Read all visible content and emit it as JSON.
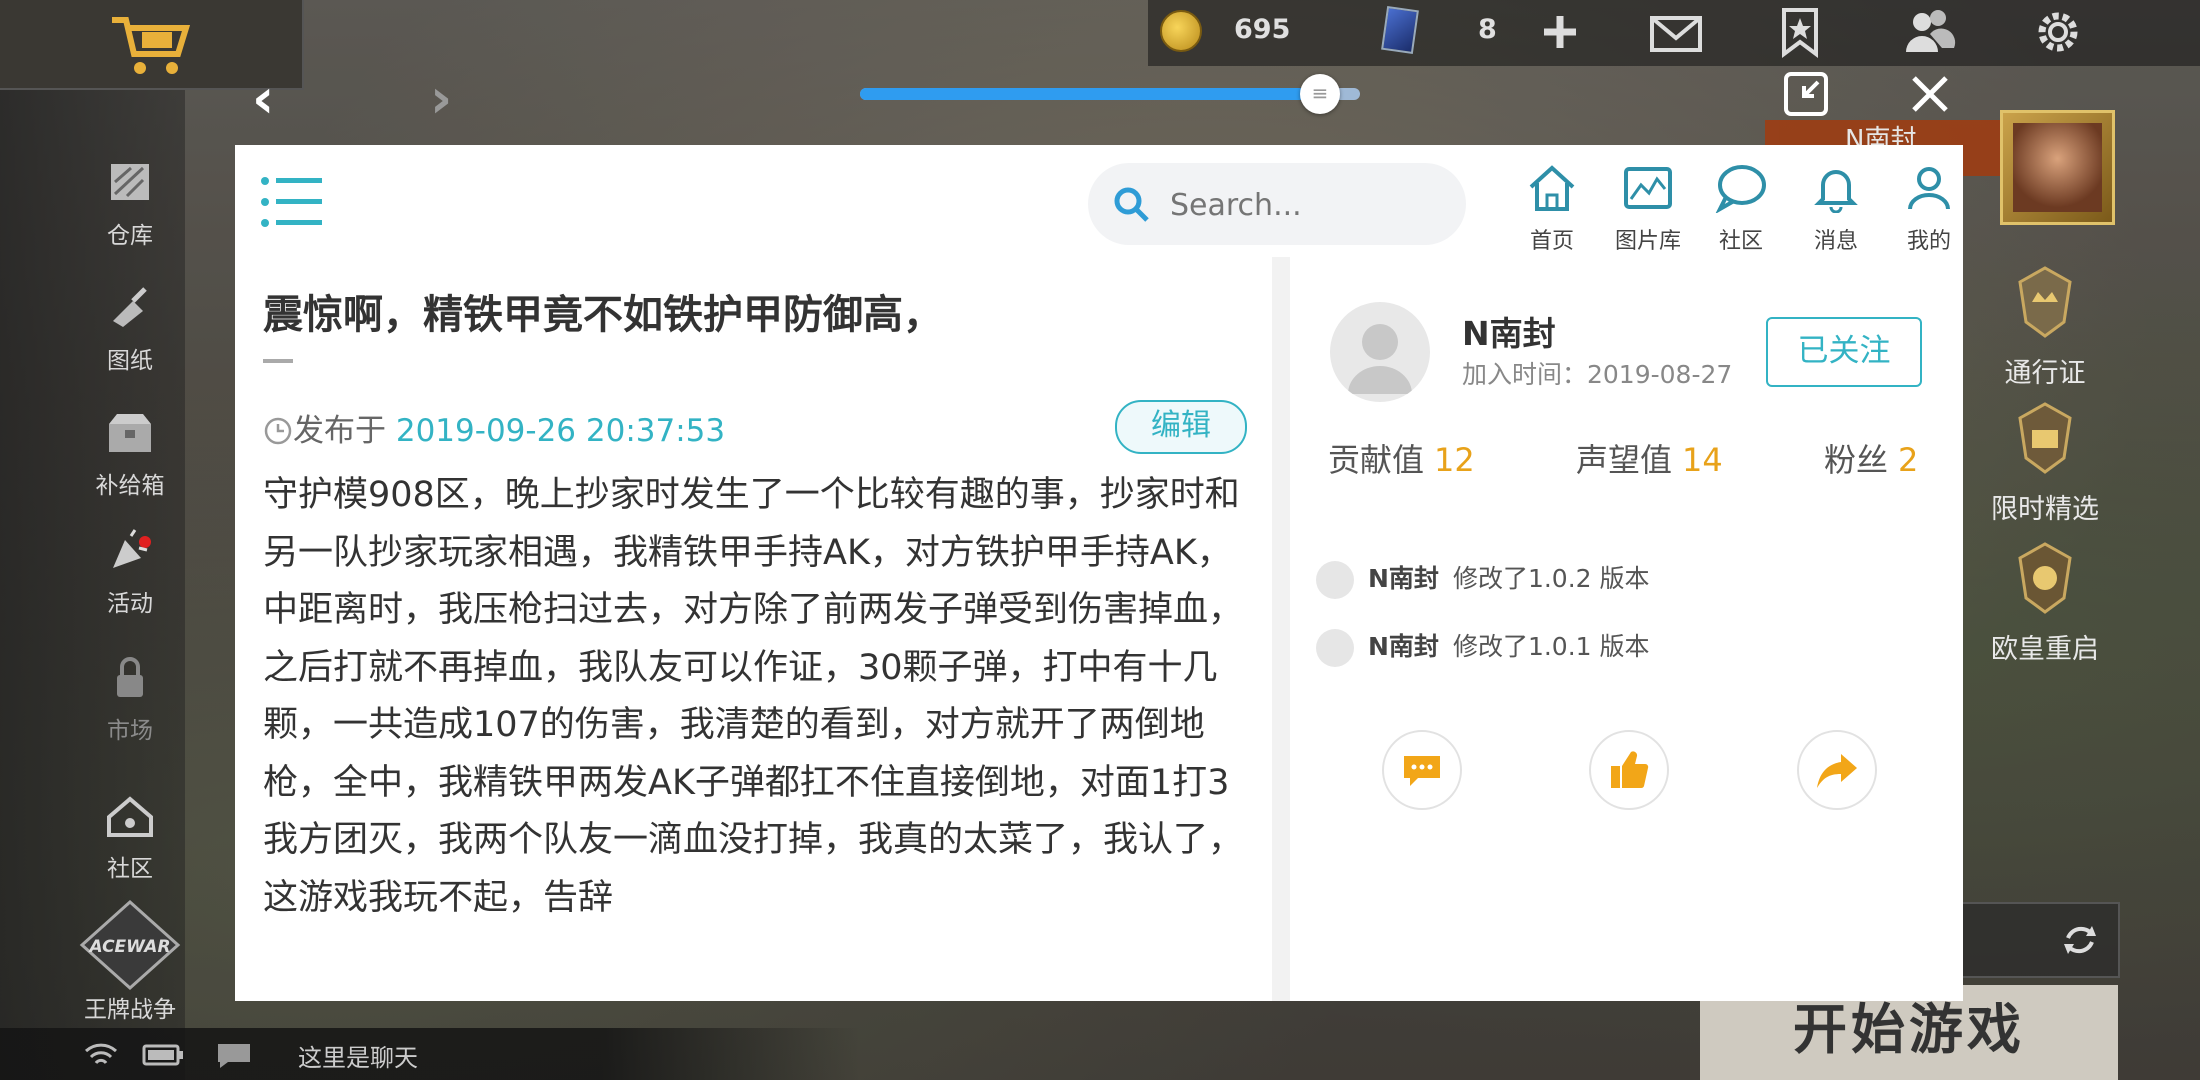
{
  "game": {
    "top_bar": {
      "coins": "695",
      "cards": "8"
    },
    "sidebar_items": [
      {
        "label": "仓库"
      },
      {
        "label": "图纸"
      },
      {
        "label": "补给箱"
      },
      {
        "label": "活动"
      },
      {
        "label": "市场"
      },
      {
        "label": "社区"
      },
      {
        "label": "王牌战争"
      }
    ],
    "right_items": [
      {
        "label": "通行证"
      },
      {
        "label": "限时精选"
      },
      {
        "label": "欧皇重启"
      }
    ],
    "player_badge": "N南封",
    "start_button": "开始游戏",
    "chat_placeholder": "这里是聊天"
  },
  "browser": {
    "progress": 0.92
  },
  "header": {
    "search_placeholder": "Search...",
    "nav": [
      {
        "label": "首页",
        "icon": "home-icon"
      },
      {
        "label": "图片库",
        "icon": "gallery-icon"
      },
      {
        "label": "社区",
        "icon": "chat-bubble-icon"
      },
      {
        "label": "消息",
        "icon": "bell-icon"
      },
      {
        "label": "我的",
        "icon": "user-icon"
      }
    ]
  },
  "article": {
    "title": "震惊啊，精铁甲竟不如铁护甲防御高，",
    "published_prefix": "发布于",
    "published_date": "2019-09-26 20:37:53",
    "edit_label": "编辑",
    "body": "守护模908区，晚上抄家时发生了一个比较有趣的事，抄家时和另一队抄家玩家相遇，我精铁甲手持AK，对方铁护甲手持AK，中距离时，我压枪扫过去，对方除了前两发子弹受到伤害掉血，之后打就不再掉血，我队友可以作证，30颗子弹，打中有十几颗，一共造成107的伤害，我清楚的看到，对方就开了两倒地枪，全中，我精铁甲两发AK子弹都扛不住直接倒地，对面1打3我方团灭，我两个队友一滴血没打掉，我真的太菜了，我认了，这游戏我玩不起，告辞"
  },
  "author": {
    "name": "N南封",
    "join_label": "加入时间：2019-08-27",
    "follow_label": "已关注",
    "stats": [
      {
        "label": "贡献值",
        "value": "12"
      },
      {
        "label": "声望值",
        "value": "14"
      },
      {
        "label": "粉丝",
        "value": "2"
      }
    ],
    "activity": [
      {
        "who": "N南封",
        "text": "修改了1.0.2 版本"
      },
      {
        "who": "N南封",
        "text": "修改了1.0.1 版本"
      }
    ]
  },
  "colors": {
    "accent": "#33b3c4",
    "stat_number": "#e8a21a",
    "progress": "#2f9cf0"
  }
}
